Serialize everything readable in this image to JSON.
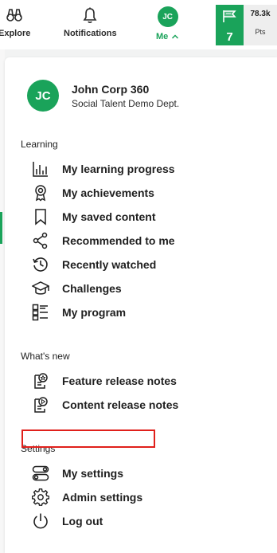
{
  "nav": {
    "explore_label": "Explore",
    "notifications_label": "Notifications",
    "me_label": "Me",
    "me_initials": "JC"
  },
  "stats": {
    "level": "7",
    "points_value": "78.3k",
    "points_label": "Pts"
  },
  "profile": {
    "initials": "JC",
    "name": "John Corp 360",
    "department": "Social Talent Demo Dept."
  },
  "sections": {
    "learning": {
      "title": "Learning",
      "items": [
        {
          "label": "My learning progress",
          "icon": "bar-chart-icon"
        },
        {
          "label": "My achievements",
          "icon": "award-icon"
        },
        {
          "label": "My saved content",
          "icon": "bookmark-icon"
        },
        {
          "label": "Recommended to me",
          "icon": "share-icon"
        },
        {
          "label": "Recently watched",
          "icon": "history-icon"
        },
        {
          "label": "Challenges",
          "icon": "graduation-cap-icon"
        },
        {
          "label": "My program",
          "icon": "checklist-icon"
        }
      ]
    },
    "whats_new": {
      "title": "What's new",
      "items": [
        {
          "label": "Feature release notes",
          "icon": "release-notes-icon"
        },
        {
          "label": "Content release notes",
          "icon": "content-notes-icon"
        }
      ]
    },
    "settings": {
      "title": "Settings",
      "items": [
        {
          "label": "My settings",
          "icon": "toggle-icon"
        },
        {
          "label": "Admin settings",
          "icon": "gear-icon"
        },
        {
          "label": "Log out",
          "icon": "power-icon"
        }
      ]
    }
  },
  "colors": {
    "brand_green": "#1aa35a",
    "highlight_red": "#e0201b"
  }
}
